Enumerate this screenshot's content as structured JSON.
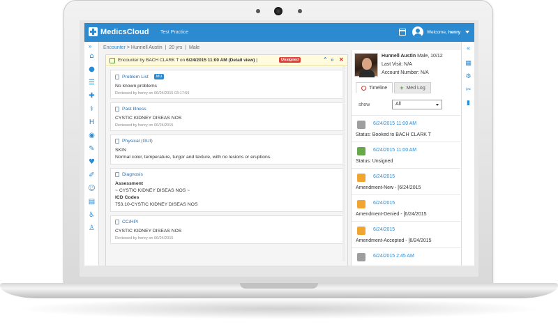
{
  "app": {
    "logo": "MedicsCloud",
    "practice": "Test Practice",
    "welcome_prefix": "Welcome,",
    "welcome_user": "henry"
  },
  "breadcrumb": {
    "link": "Encounter",
    "sep": ">",
    "patient": "Hunnell Austin",
    "age": "20 yrs",
    "sex": "Male"
  },
  "encounter": {
    "header": "Encounter by BACH CLARK T on",
    "date_bold": "6/24/2015 11:00 AM (Detail view)",
    "divider": "|",
    "status_badge": "Unsigned"
  },
  "sections": [
    {
      "title": "Problem List",
      "badge": "MU",
      "lines": [
        "No known problems"
      ],
      "meta": "Reviewed by henry on 06/24/2015 03:17:59"
    },
    {
      "title": "Past Illness",
      "lines": [
        "CYSTIC KIDNEY DISEAS NOS"
      ],
      "meta": "Reviewed by henry on 06/24/2015"
    },
    {
      "title": "Physical (GUI)",
      "lines": [
        "SKIN",
        "Normal color, temperature, turgor and texture, with no lesions or eruptions."
      ]
    },
    {
      "title": "Diagnosis",
      "bold1": "Assessment",
      "line1": "~ CYSTIC KIDNEY DISEAS NOS ~",
      "bold2": "ICD Codes",
      "line2": "753.10-CYSTIC KIDNEY DISEAS NOS"
    },
    {
      "title": "CC/HPI",
      "lines": [
        "CYSTIC KIDNEY DISEAS NOS"
      ],
      "meta": "Reviewed by henry on 06/24/2015"
    }
  ],
  "patient": {
    "name": "Hunnell Austin",
    "demo": "Male, 10/12",
    "last_visit": "Last Visit: N/A",
    "account": "Account Number: N/A"
  },
  "tabs": {
    "timeline": "Timeline",
    "medlog": "Med Log"
  },
  "filter": {
    "label": "show",
    "value": "All"
  },
  "timeline": [
    {
      "icon": "gray",
      "date": "6/24/2015 11:00 AM",
      "status": "Status: Booked to BACH CLARK T"
    },
    {
      "icon": "green",
      "date": "6/24/2015 11:00 AM",
      "status": "Status: Unsigned"
    },
    {
      "icon": "orange",
      "date": "6/24/2015",
      "status": "Amendment-New - [6/24/2015"
    },
    {
      "icon": "orange",
      "date": "6/24/2015",
      "status": "Amendment-Denied - [6/24/2015"
    },
    {
      "icon": "orange",
      "date": "6/24/2015",
      "status": "Amendment-Accepted - [6/24/2015"
    },
    {
      "icon": "gray",
      "date": "6/24/2015 2:45 AM",
      "status": ""
    }
  ],
  "colors": {
    "accent": "#2c8ad1",
    "unsigned": "#e0423a",
    "green": "#67a84a",
    "orange": "#f0a531"
  }
}
